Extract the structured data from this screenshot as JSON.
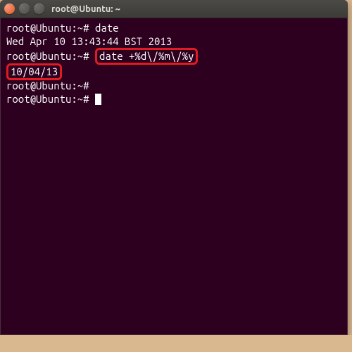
{
  "window": {
    "title": "root@Ubuntu: ~"
  },
  "terminal": {
    "prompt1": "root@Ubuntu:~# ",
    "cmd1": "date",
    "output1": "Wed Apr 10 13:43:44 BST 2013",
    "prompt2": "root@Ubuntu:~# ",
    "cmd2": "date +%d\\/%m\\/%y",
    "output2": "10/04/13",
    "prompt3": "root@Ubuntu:~# ",
    "prompt4": "root@Ubuntu:~# "
  }
}
